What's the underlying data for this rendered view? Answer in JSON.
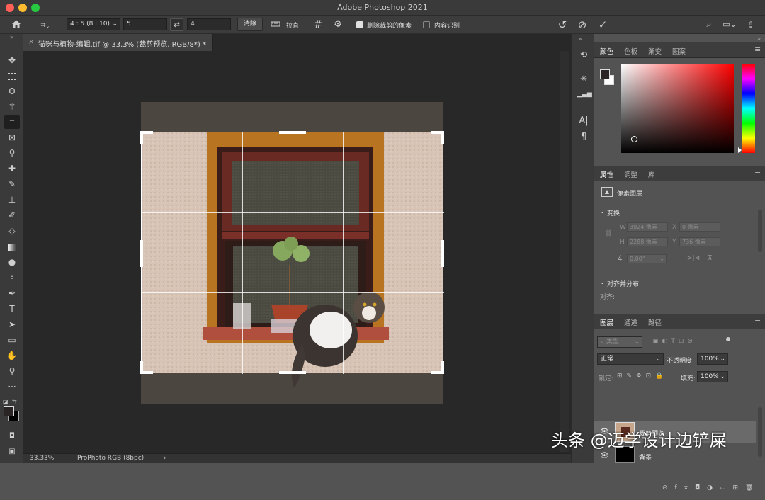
{
  "window": {
    "title": "Adobe Photoshop 2021"
  },
  "options_bar": {
    "ratio_preset": "4 : 5 (8 : 10)",
    "width_value": "5",
    "height_value": "4",
    "clear_label": "清除",
    "straighten_label": "拉直",
    "delete_cropped_label": "删除裁剪的像素",
    "delete_cropped_checked": true,
    "content_aware_label": "内容识别",
    "content_aware_checked": false
  },
  "document": {
    "tab_title": "猫咪与植物-编辑.tif @ 33.3% (裁剪预览, RGB/8*) *",
    "close_glyph": "×"
  },
  "status": {
    "zoom": "33.33%",
    "profile": "ProPhoto RGB (8bpc)",
    "arrow": "›"
  },
  "toolbar": {
    "tools": [
      "move",
      "marquee",
      "lasso",
      "magic-wand",
      "crop",
      "frame",
      "eyedropper",
      "healing",
      "brush",
      "stamp",
      "history-brush",
      "eraser",
      "gradient",
      "blur",
      "dodge",
      "pen",
      "type",
      "path-select",
      "rectangle",
      "hand",
      "zoom",
      "more"
    ]
  },
  "color_panel": {
    "tabs": [
      "颜色",
      "色板",
      "渐变",
      "图案"
    ],
    "active": "颜色",
    "foreground": "#2a2424",
    "background": "#ffffff"
  },
  "properties_panel": {
    "tabs": [
      "属性",
      "调整",
      "库"
    ],
    "active": "属性",
    "layer_type": "像素图层",
    "section_transform": "变换",
    "w_label": "W",
    "w_value": "3024 像素",
    "x_label": "X",
    "x_value": "0 像素",
    "h_label": "H",
    "h_value": "2288 像素",
    "y_label": "Y",
    "y_value": "736 像素",
    "angle_value": "0.00°",
    "section_align": "对齐并分布",
    "align_sub": "对齐:"
  },
  "layers_panel": {
    "tabs": [
      "图层",
      "通道",
      "路径"
    ],
    "active": "图层",
    "filter_kind": "类型",
    "blend_mode": "正常",
    "opacity_label": "不透明度:",
    "opacity_value": "100%",
    "lock_label": "锁定:",
    "fill_label": "填充:",
    "fill_value": "100%",
    "layers": [
      {
        "name": "裁剪预览",
        "selected": true
      },
      {
        "name": "背景",
        "selected": false
      }
    ]
  },
  "watermark": "头条 @迈学设计边铲屎"
}
